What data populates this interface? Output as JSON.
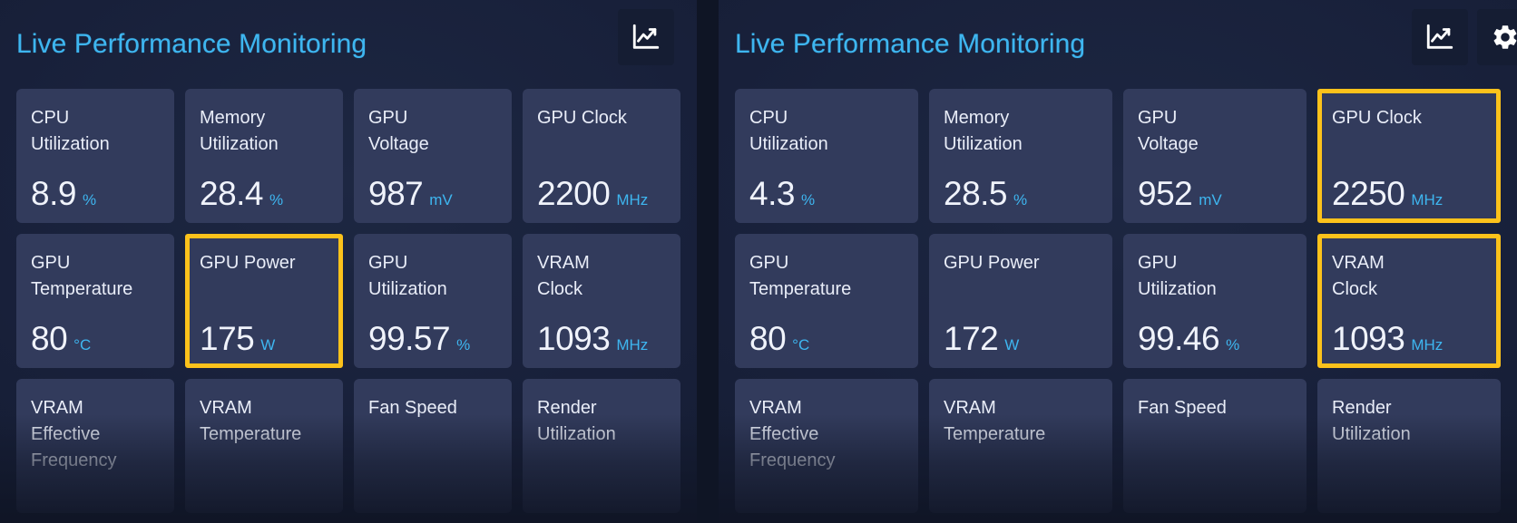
{
  "panels": [
    {
      "title": "Live Performance Monitoring",
      "actions": [
        {
          "name": "chart-icon",
          "label": "chart-icon"
        }
      ],
      "metrics": [
        {
          "label": "CPU\nUtilization",
          "value": "8.9",
          "unit": "%",
          "highlighted": false
        },
        {
          "label": "Memory\nUtilization",
          "value": "28.4",
          "unit": "%",
          "highlighted": false
        },
        {
          "label": "GPU\nVoltage",
          "value": "987",
          "unit": "mV",
          "highlighted": false
        },
        {
          "label": "GPU Clock",
          "value": "2200",
          "unit": "MHz",
          "highlighted": false
        },
        {
          "label": "GPU\nTemperature",
          "value": "80",
          "unit": "°C",
          "highlighted": false
        },
        {
          "label": "GPU Power",
          "value": "175",
          "unit": "W",
          "highlighted": true
        },
        {
          "label": "GPU\nUtilization",
          "value": "99.57",
          "unit": "%",
          "highlighted": false
        },
        {
          "label": "VRAM\nClock",
          "value": "1093",
          "unit": "MHz",
          "highlighted": false
        },
        {
          "label": "VRAM\nEffective\nFrequency",
          "value": "",
          "unit": "",
          "highlighted": false
        },
        {
          "label": "VRAM\nTemperature",
          "value": "",
          "unit": "",
          "highlighted": false
        },
        {
          "label": "Fan Speed",
          "value": "",
          "unit": "",
          "highlighted": false
        },
        {
          "label": "Render\nUtilization",
          "value": "",
          "unit": "",
          "highlighted": false
        }
      ]
    },
    {
      "title": "Live Performance Monitoring",
      "actions": [
        {
          "name": "chart-icon",
          "label": "chart-icon"
        },
        {
          "name": "settings-icon",
          "label": "settings-icon"
        }
      ],
      "metrics": [
        {
          "label": "CPU\nUtilization",
          "value": "4.3",
          "unit": "%",
          "highlighted": false
        },
        {
          "label": "Memory\nUtilization",
          "value": "28.5",
          "unit": "%",
          "highlighted": false
        },
        {
          "label": "GPU\nVoltage",
          "value": "952",
          "unit": "mV",
          "highlighted": false
        },
        {
          "label": "GPU Clock",
          "value": "2250",
          "unit": "MHz",
          "highlighted": true
        },
        {
          "label": "GPU\nTemperature",
          "value": "80",
          "unit": "°C",
          "highlighted": false
        },
        {
          "label": "GPU Power",
          "value": "172",
          "unit": "W",
          "highlighted": false
        },
        {
          "label": "GPU\nUtilization",
          "value": "99.46",
          "unit": "%",
          "highlighted": false
        },
        {
          "label": "VRAM\nClock",
          "value": "1093",
          "unit": "MHz",
          "highlighted": true
        },
        {
          "label": "VRAM\nEffective\nFrequency",
          "value": "",
          "unit": "",
          "highlighted": false
        },
        {
          "label": "VRAM\nTemperature",
          "value": "",
          "unit": "",
          "highlighted": false
        },
        {
          "label": "Fan Speed",
          "value": "",
          "unit": "",
          "highlighted": false
        },
        {
          "label": "Render\nUtilization",
          "value": "",
          "unit": "",
          "highlighted": false
        }
      ]
    }
  ],
  "colors": {
    "accent_title": "#3eb6f0",
    "accent_unit": "#3eb6f0",
    "highlight_border": "#fcc21b",
    "card_bg": "#323b5c",
    "panel_bg": "#18203a"
  }
}
